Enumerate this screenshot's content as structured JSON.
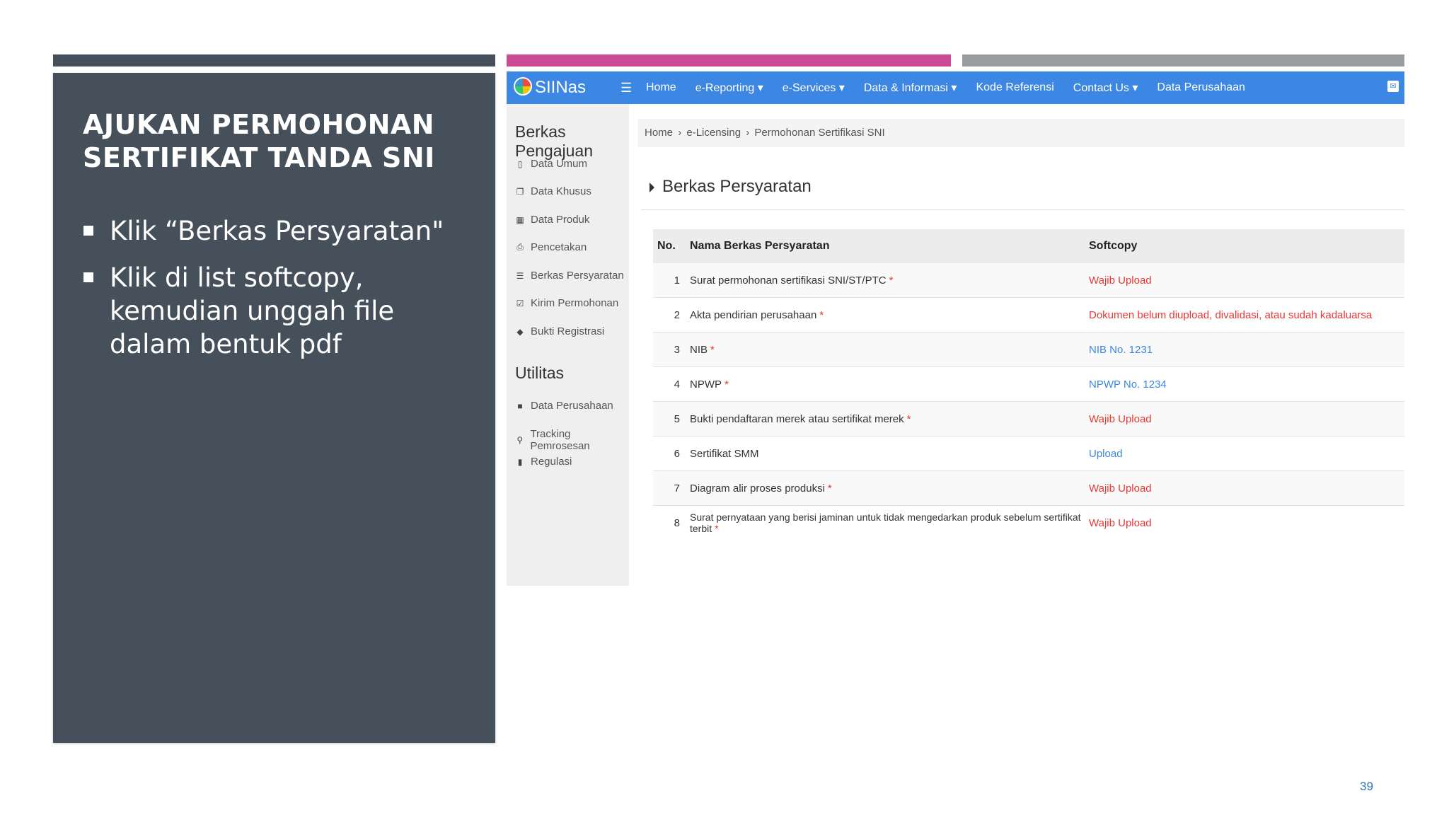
{
  "slide": {
    "title": "AJUKAN PERMOHONAN SERTIFIKAT  TANDA SNI",
    "bullets": [
      "Klik “Berkas Persyaratan\"",
      "Klik di list softcopy, kemudian unggah file dalam bentuk pdf"
    ],
    "page_number": "39"
  },
  "colors": {
    "panel_bg": "#46505a",
    "accent_pink": "#c94b93",
    "accent_gray": "#9a9c9e",
    "navbar_blue": "#3b87e3",
    "required_red": "#e53935",
    "link_blue": "#3b87e3"
  },
  "app": {
    "brand": "SIINas",
    "nav": [
      "Home",
      "e-Reporting ▾",
      "e-Services ▾",
      "Data & Informasi ▾",
      "Kode Referensi",
      "Contact Us ▾",
      "Data Perusahaan"
    ],
    "sidebar": {
      "section1": "Berkas Pengajuan",
      "items1": [
        {
          "label": "Data Umum",
          "icon": "file-icon"
        },
        {
          "label": "Data Khusus",
          "icon": "files-icon"
        },
        {
          "label": "Data Produk",
          "icon": "table-icon"
        },
        {
          "label": "Pencetakan",
          "icon": "print-icon"
        },
        {
          "label": "Berkas Persyaratan",
          "icon": "list-icon"
        },
        {
          "label": "Kirim Permohonan",
          "icon": "checkbox-icon"
        },
        {
          "label": "Bukti Registrasi",
          "icon": "tag-icon"
        }
      ],
      "section2": "Utilitas",
      "items2": [
        {
          "label": "Data Perusahaan",
          "icon": "briefcase-icon"
        },
        {
          "label": "Tracking Pemrosesan",
          "icon": "search-icon"
        },
        {
          "label": "Regulasi",
          "icon": "book-icon"
        }
      ]
    },
    "breadcrumb": [
      "Home",
      "e-Licensing",
      "Permohonan Sertifikasi SNI"
    ],
    "section_title": "Berkas Persyaratan",
    "table": {
      "headers": [
        "No.",
        "Nama Berkas Persyaratan",
        "Softcopy"
      ],
      "rows": [
        {
          "no": "1",
          "name": "Surat permohonan sertifikasi SNI/ST/PTC",
          "required": true,
          "softcopy": "Wajib Upload",
          "status": "red"
        },
        {
          "no": "2",
          "name": "Akta pendirian perusahaan",
          "required": true,
          "softcopy": "Dokumen belum diupload, divalidasi, atau sudah kadaluarsa",
          "status": "red"
        },
        {
          "no": "3",
          "name": "NIB",
          "required": true,
          "softcopy": "NIB No. 1231",
          "status": "blue"
        },
        {
          "no": "4",
          "name": "NPWP",
          "required": true,
          "softcopy": "NPWP No. 1234",
          "status": "blue"
        },
        {
          "no": "5",
          "name": "Bukti pendaftaran merek atau sertifikat merek",
          "required": true,
          "softcopy": "Wajib Upload",
          "status": "red"
        },
        {
          "no": "6",
          "name": "Sertifikat SMM",
          "required": false,
          "softcopy": "Upload",
          "status": "blue"
        },
        {
          "no": "7",
          "name": "Diagram alir proses produksi",
          "required": true,
          "softcopy": "Wajib Upload",
          "status": "red"
        },
        {
          "no": "8",
          "name": "Surat pernyataan yang berisi jaminan untuk tidak mengedarkan produk sebelum sertifikat terbit",
          "required": true,
          "softcopy": "Wajib Upload",
          "status": "red"
        }
      ],
      "required_mark": "*"
    }
  }
}
